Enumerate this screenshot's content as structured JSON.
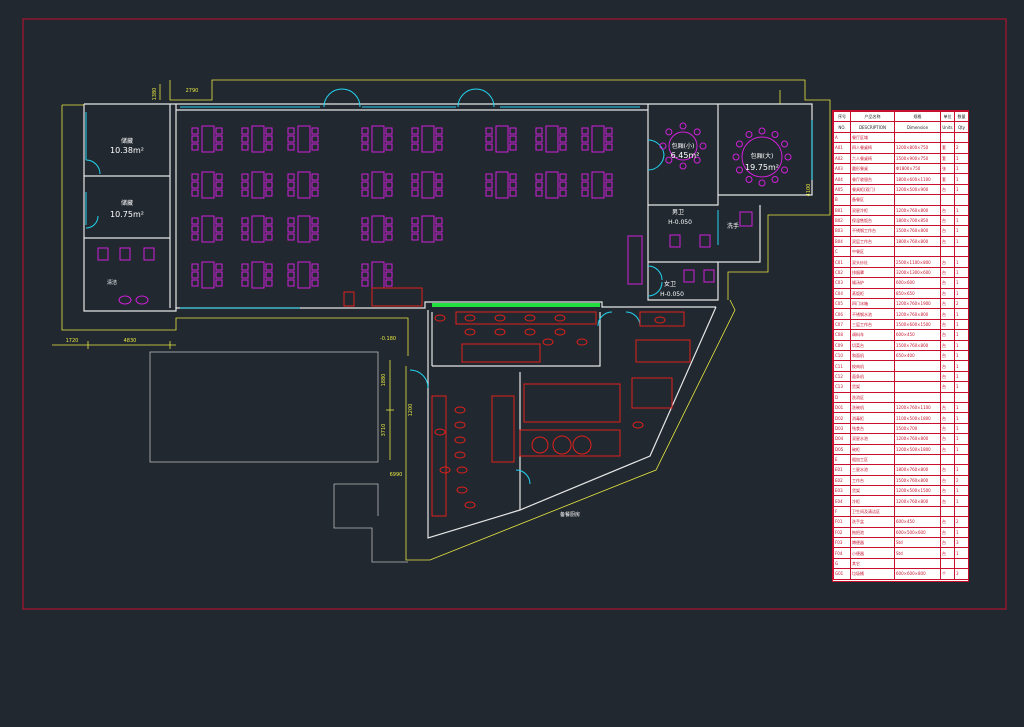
{
  "colors": {
    "background": "#212830",
    "border": "#c8102e",
    "wall": "#e8e8e8",
    "furniture": "#d020d8",
    "kitchen": "#e0201a",
    "door": "#22d4f0",
    "dimension": "#e8e840",
    "hatch": "#22e040"
  },
  "rooms": {
    "storage_a": {
      "name": "储藏",
      "area": "10.38m²"
    },
    "storage_b": {
      "name": "储藏",
      "area": "10.75m²"
    },
    "private_small": {
      "name": "包厢(小)",
      "area": "6.45m²"
    },
    "private_large": {
      "name": "包厢(大)",
      "area": "19.75m²"
    },
    "toilet_m": {
      "name": "男卫",
      "level": "H-0.050"
    },
    "toilet_f": {
      "name": "女卫",
      "level": "H-0.050"
    },
    "wash": {
      "name": "洗手"
    },
    "cleaning": {
      "name": "清洁"
    },
    "kitchen_label": "备餐厨房"
  },
  "dimensions": {
    "d1": "2790",
    "d2": "1380",
    "d3": "1720",
    "d4": "4830",
    "d5": "-0.180",
    "d6": "1880",
    "d7": "1200",
    "d8": "3710",
    "d9": "6990",
    "d10": "4100"
  },
  "legend": {
    "headers": [
      "序号",
      "产品名称",
      "规格",
      "单位",
      "数量"
    ],
    "headers_en": [
      "NO.",
      "DESCRIPTION",
      "Dimension",
      "Units",
      "Qty"
    ],
    "rows": [
      {
        "t": "sec",
        "a": "A",
        "b": "餐厅区域"
      },
      {
        "t": "row",
        "a": "A01",
        "b": "四人餐桌椅",
        "c": "1200×800×750",
        "d": "套",
        "e": "2"
      },
      {
        "t": "row",
        "a": "A02",
        "b": "六人餐桌椅",
        "c": "1500×900×750",
        "d": "套",
        "e": "1"
      },
      {
        "t": "row",
        "a": "A03",
        "b": "圆形餐桌",
        "c": "Φ1800×750",
        "d": "张",
        "e": "1"
      },
      {
        "t": "row",
        "a": "A04",
        "b": "餐厅收银台",
        "c": "1800×600×1100",
        "d": "套",
        "e": "1"
      },
      {
        "t": "row",
        "a": "A05",
        "b": "餐具柜(双门)",
        "c": "1200×500×900",
        "d": "台",
        "e": "1"
      },
      {
        "t": "sec",
        "a": "B",
        "b": "备餐区"
      },
      {
        "t": "row",
        "a": "B01",
        "b": "双星冷柜",
        "c": "1200×760×800",
        "d": "台",
        "e": "1"
      },
      {
        "t": "row",
        "a": "B02",
        "b": "保温售饭台",
        "c": "1800×700×850",
        "d": "台",
        "e": "1"
      },
      {
        "t": "row",
        "a": "B03",
        "b": "不锈钢工作台",
        "c": "1500×760×800",
        "d": "台",
        "e": "1"
      },
      {
        "t": "row",
        "a": "B04",
        "b": "双层工作台",
        "c": "1800×760×800",
        "d": "台",
        "e": "1"
      },
      {
        "t": "sec",
        "a": "C",
        "b": "中餐区"
      },
      {
        "t": "row",
        "a": "C01",
        "b": "双头炒灶",
        "c": "2500×1100×800",
        "d": "台",
        "e": "1"
      },
      {
        "t": "row",
        "a": "C02",
        "b": "排烟罩",
        "c": "3200×1300×600",
        "d": "台",
        "e": "1"
      },
      {
        "t": "row",
        "a": "C03",
        "b": "矮汤炉",
        "c": "600×600",
        "d": "台",
        "e": "1"
      },
      {
        "t": "row",
        "a": "C04",
        "b": "蒸饭柜",
        "c": "850×650",
        "d": "台",
        "e": "1"
      },
      {
        "t": "row",
        "a": "C05",
        "b": "四门冰箱",
        "c": "1200×760×1900",
        "d": "台",
        "e": "2"
      },
      {
        "t": "row",
        "a": "C06",
        "b": "不锈钢水池",
        "c": "1200×760×800",
        "d": "台",
        "e": "1"
      },
      {
        "t": "row",
        "a": "C07",
        "b": "三层工作台",
        "c": "1500×600×1500",
        "d": "台",
        "e": "1"
      },
      {
        "t": "row",
        "a": "C08",
        "b": "调料车",
        "c": "600×450",
        "d": "台",
        "e": "1"
      },
      {
        "t": "row",
        "a": "C09",
        "b": "切菜台",
        "c": "1500×760×800",
        "d": "台",
        "e": "1"
      },
      {
        "t": "row",
        "a": "C10",
        "b": "和面机",
        "c": "650×400",
        "d": "台",
        "e": "1"
      },
      {
        "t": "row",
        "a": "C11",
        "b": "绞肉机",
        "c": "",
        "d": "台",
        "e": "1"
      },
      {
        "t": "row",
        "a": "C12",
        "b": "面条机",
        "c": "",
        "d": "台",
        "e": "1"
      },
      {
        "t": "row",
        "a": "C13",
        "b": "货架",
        "c": "",
        "d": "台",
        "e": "1"
      },
      {
        "t": "sec",
        "a": "D",
        "b": "洗消区"
      },
      {
        "t": "row",
        "a": "D01",
        "b": "洗碗机",
        "c": "1200×760×1100",
        "d": "台",
        "e": "1"
      },
      {
        "t": "row",
        "a": "D02",
        "b": "消毒柜",
        "c": "1100×500×1800",
        "d": "台",
        "e": "1"
      },
      {
        "t": "row",
        "a": "D03",
        "b": "残食台",
        "c": "1500×700",
        "d": "台",
        "e": "1"
      },
      {
        "t": "row",
        "a": "D04",
        "b": "双星水池",
        "c": "1200×760×800",
        "d": "台",
        "e": "1"
      },
      {
        "t": "row",
        "a": "D05",
        "b": "碗柜",
        "c": "1200×500×1800",
        "d": "台",
        "e": "1"
      },
      {
        "t": "sec",
        "a": "E",
        "b": "粗加工区"
      },
      {
        "t": "row",
        "a": "E01",
        "b": "三星水池",
        "c": "1800×760×800",
        "d": "台",
        "e": "1"
      },
      {
        "t": "row",
        "a": "E02",
        "b": "工作台",
        "c": "1500×760×800",
        "d": "台",
        "e": "2"
      },
      {
        "t": "row",
        "a": "E03",
        "b": "货架",
        "c": "1200×500×1500",
        "d": "台",
        "e": "1"
      },
      {
        "t": "row",
        "a": "E04",
        "b": "冷柜",
        "c": "1200×760×800",
        "d": "台",
        "e": "1"
      },
      {
        "t": "sec",
        "a": "F",
        "b": "卫生间及清洁区"
      },
      {
        "t": "row",
        "a": "F01",
        "b": "洗手盆",
        "c": "600×450",
        "d": "台",
        "e": "2"
      },
      {
        "t": "row",
        "a": "F02",
        "b": "拖把池",
        "c": "600×500×600",
        "d": "台",
        "e": "1"
      },
      {
        "t": "row",
        "a": "F03",
        "b": "蹲便器",
        "c": "Std",
        "d": "台",
        "e": "3"
      },
      {
        "t": "row",
        "a": "F04",
        "b": "小便器",
        "c": "Std",
        "d": "台",
        "e": "1"
      },
      {
        "t": "sec",
        "a": "G",
        "b": "其它"
      },
      {
        "t": "row",
        "a": "G01",
        "b": "垃圾桶",
        "c": "600×600×800",
        "d": "个",
        "e": "3"
      }
    ]
  }
}
